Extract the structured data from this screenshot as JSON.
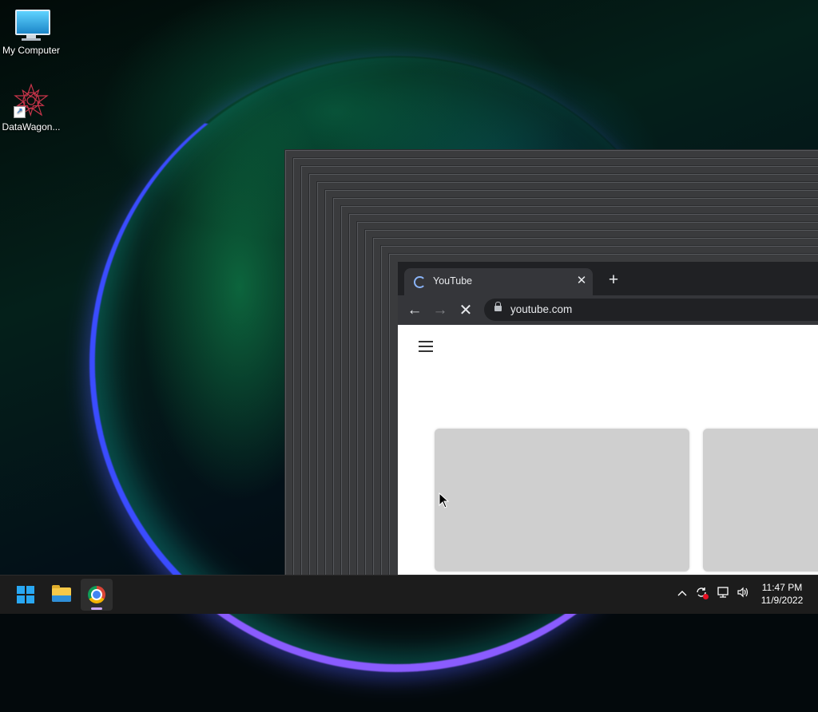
{
  "desktop": {
    "icons": [
      {
        "label": "My Computer",
        "icon": "computer-monitor-icon"
      },
      {
        "label": "DataWagon...",
        "icon": "datawagon-logo-icon"
      }
    ]
  },
  "browser": {
    "tab": {
      "title": "YouTube",
      "state": "loading"
    },
    "new_tab_glyph": "+",
    "close_tab_glyph": "✕",
    "toolbar": {
      "back_glyph": "←",
      "forward_glyph": "→",
      "stop_glyph": "✕"
    },
    "address": "youtube.com",
    "page": {
      "menu_icon": "hamburger-menu-icon"
    }
  },
  "taskbar": {
    "pinned": [
      "windows-start-icon",
      "file-explorer-icon",
      "chrome-icon"
    ],
    "tray": {
      "chevron_glyph": "^",
      "clock": {
        "time": "11:47 PM",
        "date": "11/9/2022"
      }
    }
  },
  "colors": {
    "accent": "#29a8f3",
    "browser_dark": "#202124",
    "toolbar": "#35363a",
    "placeholder": "#cfcfcf"
  }
}
